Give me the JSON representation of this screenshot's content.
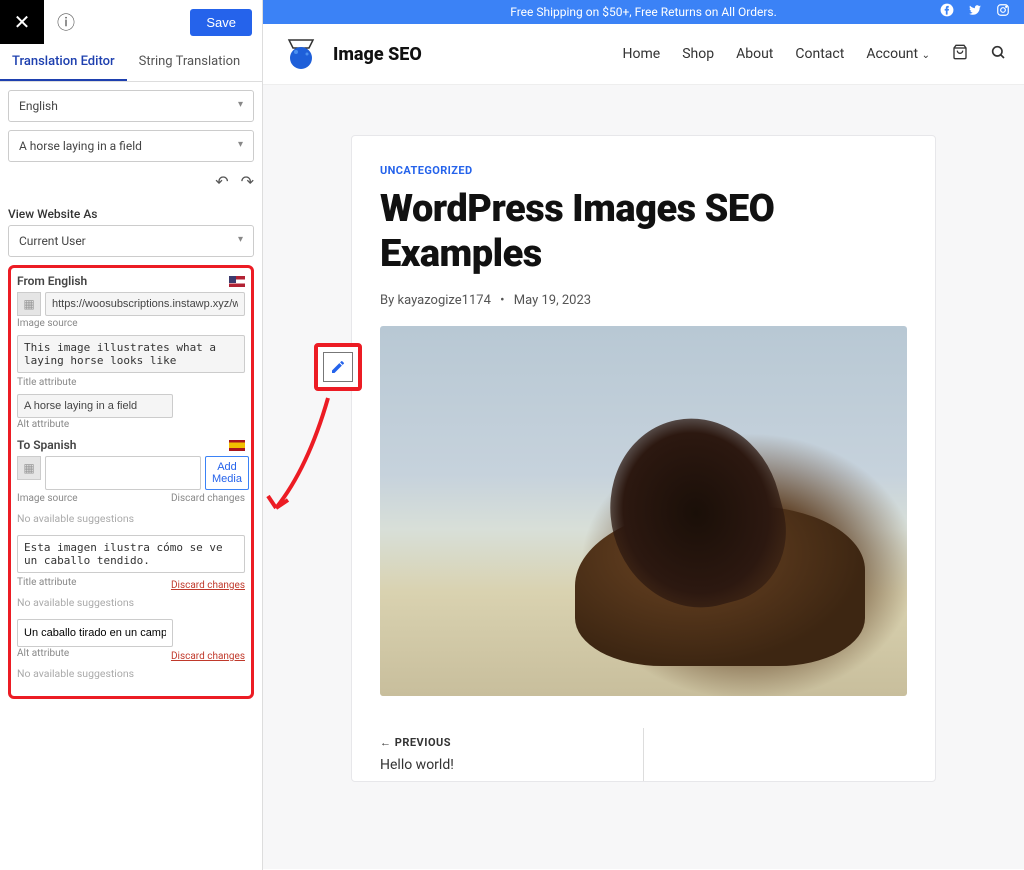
{
  "topbar": {
    "save": "Save"
  },
  "tabs": {
    "editor": "Translation Editor",
    "string": "String Translation"
  },
  "selects": {
    "language": "English",
    "item": "A horse laying in a field"
  },
  "view_as_label": "View Website As",
  "view_as_value": "Current User",
  "from": {
    "heading": "From English",
    "image_source_value": "https://woosubscriptions.instawp.xyz/wp-conte",
    "image_source_label": "Image source",
    "title_value": "This image illustrates what a laying horse looks like",
    "title_label": "Title attribute",
    "alt_value": "A horse laying in a field",
    "alt_label": "Alt attribute"
  },
  "to": {
    "heading": "To Spanish",
    "add_media": "Add Media",
    "image_source_label": "Image source",
    "discard": "Discard changes",
    "no_suggestions": "No available suggestions",
    "title_value": "Esta imagen ilustra cómo se ve un caballo tendido.",
    "title_label": "Title attribute",
    "alt_value": "Un caballo tirado en un campo",
    "alt_label": "Alt attribute"
  },
  "site": {
    "promo": "Free Shipping on $50+, Free Returns on All Orders.",
    "brand": "Image SEO",
    "nav": {
      "home": "Home",
      "shop": "Shop",
      "about": "About",
      "contact": "Contact",
      "account": "Account"
    }
  },
  "post": {
    "category": "UNCATEGORIZED",
    "title": "WordPress Images SEO Examples",
    "by": "By",
    "author": "kayazogize1174",
    "date": "May 19, 2023",
    "prev_label": "PREVIOUS",
    "prev_title": "Hello world!"
  }
}
